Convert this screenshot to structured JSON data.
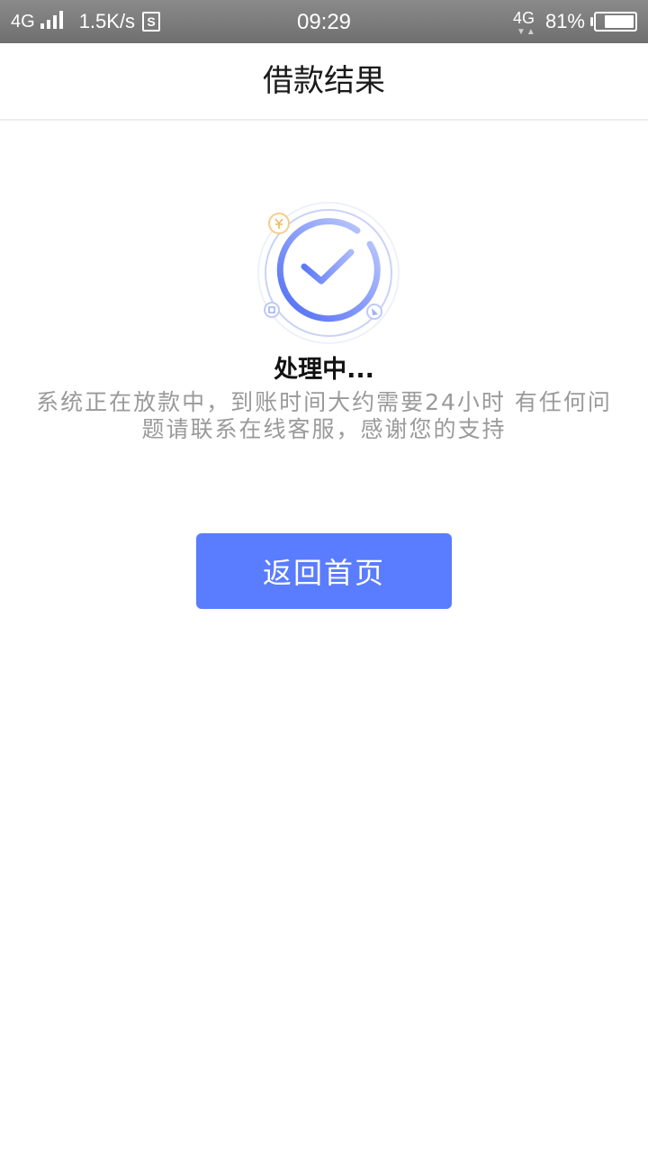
{
  "status_bar": {
    "network_left": "4G",
    "speed": "1.5K/s",
    "s_icon_label": "S",
    "time": "09:29",
    "network_right": "4G",
    "battery_percent": "81%",
    "battery_level": 0.81
  },
  "header": {
    "title": "借款结果"
  },
  "result": {
    "title": "处理中...",
    "description": "系统正在放款中，到账时间大约需要24小时 有任何问题请联系在线客服，感谢您的支持",
    "icon": "check-circle-icon",
    "accent_color": "#5a7cff"
  },
  "actions": {
    "home_button_label": "返回首页"
  }
}
